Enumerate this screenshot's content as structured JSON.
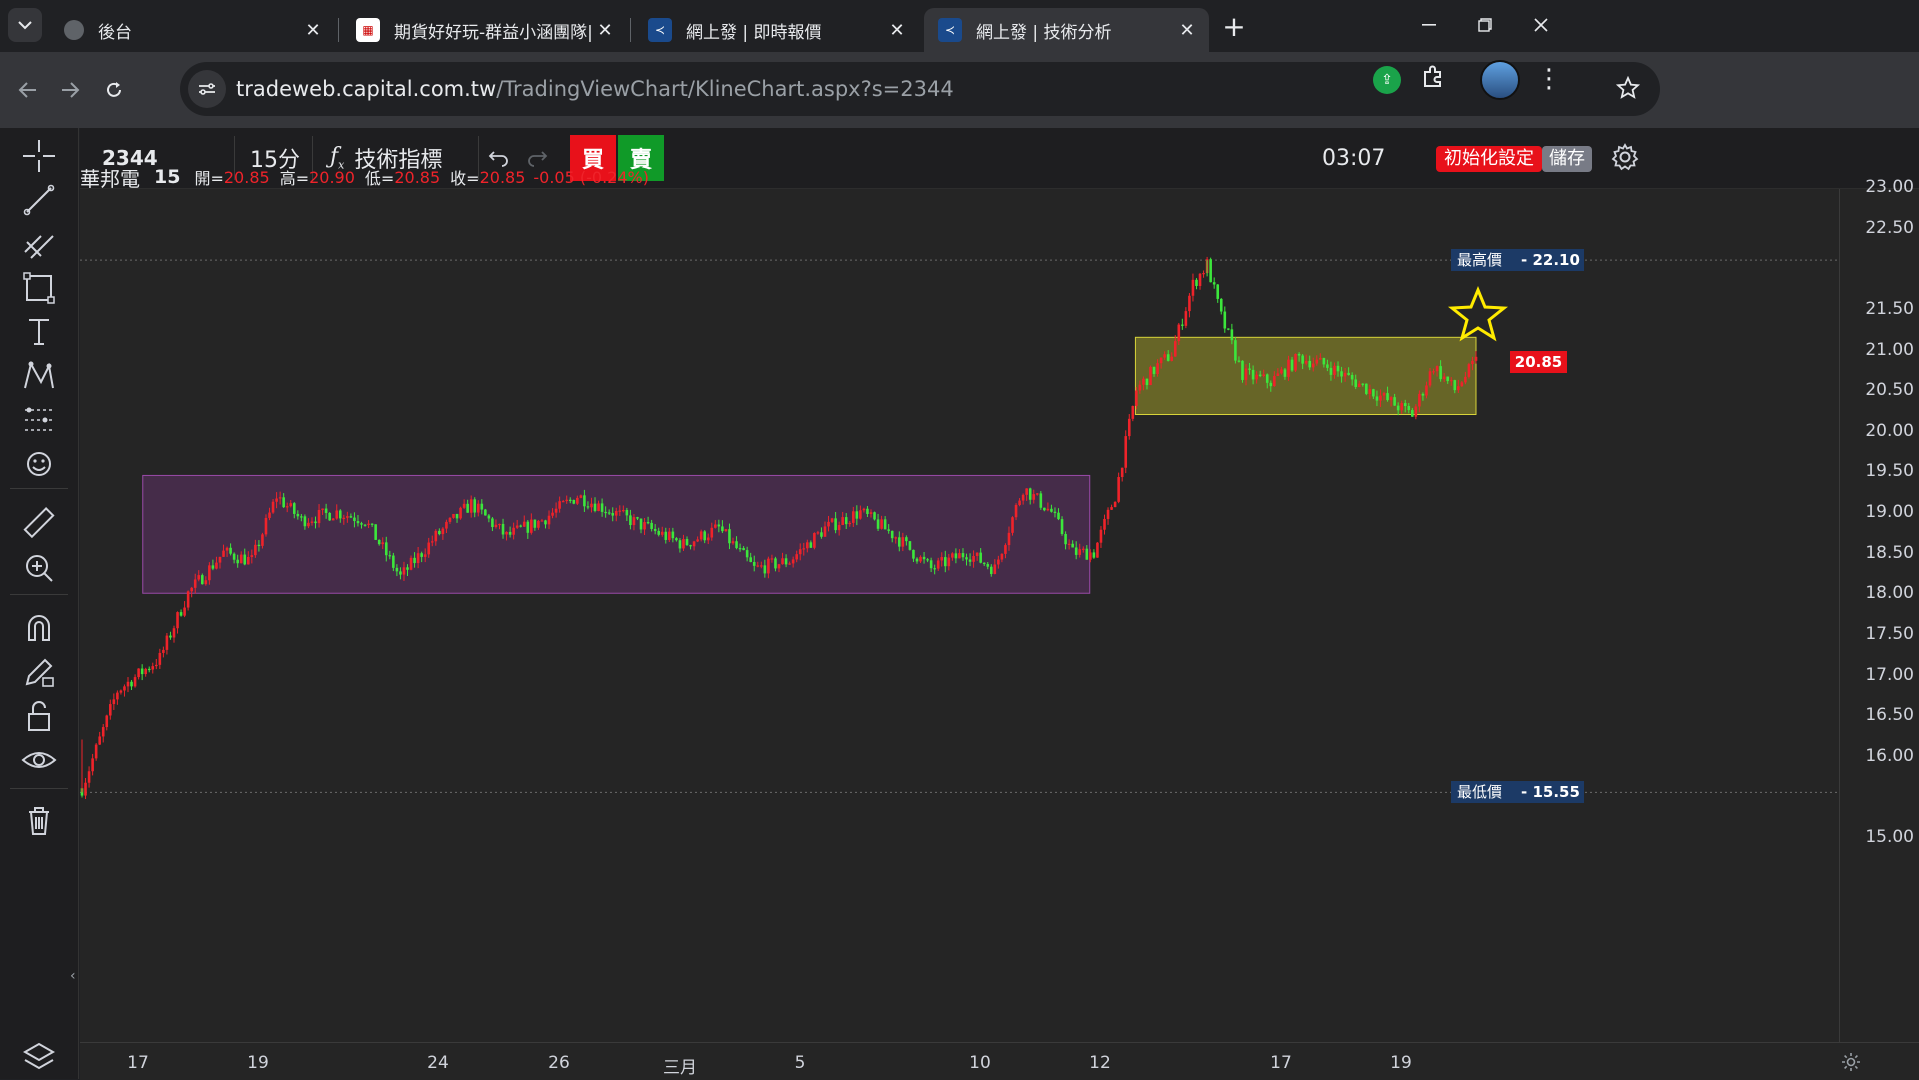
{
  "browser": {
    "tabs": [
      {
        "title": "後台",
        "active": false
      },
      {
        "title": "期貨好好玩-群益小涵團隊|唯一",
        "active": false
      },
      {
        "title": "網上發 | 即時報價",
        "active": false
      },
      {
        "title": "網上發 | 技術分析",
        "active": true
      }
    ],
    "url_host": "tradeweb.capital.com.tw",
    "url_path": "/TradingViewChart/KlineChart.aspx?s=2344"
  },
  "toolbar": {
    "symbol": "2344",
    "interval": "15分",
    "indicators_label": "技術指標",
    "buy_label": "買",
    "sell_label": "賣",
    "clock": "03:07",
    "reset_label": "初始化設定",
    "save_label": "儲存"
  },
  "legend": {
    "name": "華邦電",
    "interval": "15",
    "open_label": "開=",
    "open": "20.85",
    "high_label": "高=",
    "high": "20.90",
    "low_label": "低=",
    "low": "20.85",
    "close_label": "收=",
    "close": "20.85",
    "change": "-0.05 (-0.24%)"
  },
  "price_axis": {
    "ticks": [
      "23.00",
      "22.50",
      "21.50",
      "21.00",
      "20.50",
      "20.00",
      "19.50",
      "19.00",
      "18.50",
      "18.00",
      "17.50",
      "17.00",
      "16.50",
      "16.00",
      "15.00"
    ],
    "high_label": "最高價",
    "high_value": "22.10",
    "low_label": "最低價",
    "low_value": "15.55",
    "last_value": "20.85"
  },
  "time_axis": {
    "ticks": [
      "17",
      "19",
      "24",
      "26",
      "三月",
      "5",
      "10",
      "12",
      "17",
      "19"
    ]
  },
  "colors": {
    "up": "#ef232a",
    "down": "#3ce63c",
    "buy_bg": "#e8111a",
    "sell_bg": "#109a28",
    "range1": "#7b3a86",
    "range2": "#b7b32a",
    "star": "#ffeb00"
  },
  "chart_data": {
    "type": "candlestick",
    "ylim": [
      15.0,
      23.0
    ],
    "x_ticks": [
      "17",
      "19",
      "24",
      "26",
      "三月",
      "5",
      "10",
      "12",
      "17",
      "19"
    ],
    "highest": 22.1,
    "lowest": 15.55,
    "last": 20.85,
    "anchors": [
      {
        "i": 0,
        "p": 15.6
      },
      {
        "i": 10,
        "p": 16.8
      },
      {
        "i": 22,
        "p": 17.2
      },
      {
        "i": 30,
        "p": 18.0
      },
      {
        "i": 40,
        "p": 18.5
      },
      {
        "i": 48,
        "p": 18.4
      },
      {
        "i": 55,
        "p": 19.2
      },
      {
        "i": 62,
        "p": 18.9
      },
      {
        "i": 72,
        "p": 19.0
      },
      {
        "i": 80,
        "p": 18.9
      },
      {
        "i": 90,
        "p": 18.2
      },
      {
        "i": 100,
        "p": 18.7
      },
      {
        "i": 110,
        "p": 19.1
      },
      {
        "i": 120,
        "p": 18.7
      },
      {
        "i": 130,
        "p": 18.9
      },
      {
        "i": 140,
        "p": 19.2
      },
      {
        "i": 150,
        "p": 19.0
      },
      {
        "i": 160,
        "p": 18.8
      },
      {
        "i": 170,
        "p": 18.6
      },
      {
        "i": 180,
        "p": 18.8
      },
      {
        "i": 190,
        "p": 18.3
      },
      {
        "i": 200,
        "p": 18.4
      },
      {
        "i": 210,
        "p": 18.8
      },
      {
        "i": 220,
        "p": 19.0
      },
      {
        "i": 230,
        "p": 18.7
      },
      {
        "i": 240,
        "p": 18.3
      },
      {
        "i": 250,
        "p": 18.5
      },
      {
        "i": 258,
        "p": 18.3
      },
      {
        "i": 266,
        "p": 19.3
      },
      {
        "i": 274,
        "p": 19.0
      },
      {
        "i": 280,
        "p": 18.5
      },
      {
        "i": 286,
        "p": 18.5
      },
      {
        "i": 292,
        "p": 19.2
      },
      {
        "i": 298,
        "p": 20.5
      },
      {
        "i": 304,
        "p": 20.8
      },
      {
        "i": 308,
        "p": 20.95
      },
      {
        "i": 314,
        "p": 21.8
      },
      {
        "i": 318,
        "p": 22.05
      },
      {
        "i": 322,
        "p": 21.4
      },
      {
        "i": 328,
        "p": 20.7
      },
      {
        "i": 336,
        "p": 20.6
      },
      {
        "i": 344,
        "p": 20.9
      },
      {
        "i": 352,
        "p": 20.8
      },
      {
        "i": 360,
        "p": 20.6
      },
      {
        "i": 368,
        "p": 20.4
      },
      {
        "i": 376,
        "p": 20.2
      },
      {
        "i": 382,
        "p": 20.8
      },
      {
        "i": 388,
        "p": 20.5
      },
      {
        "i": 394,
        "p": 20.85
      }
    ],
    "ranges": [
      {
        "from_i": 20,
        "to_i": 282,
        "low": 18.0,
        "high": 19.45
      },
      {
        "from_i": 300,
        "to_i": 394,
        "low": 20.2,
        "high": 21.15
      }
    ]
  }
}
